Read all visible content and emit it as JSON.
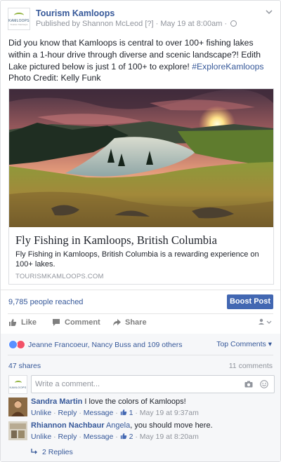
{
  "post": {
    "page_name": "Tourism Kamloops",
    "logo_text": "KAMLOOPS",
    "logo_sub": "Tourism Kamloops",
    "published_by": "Published by Shannon McLeod [?] · May 19 at 8:00am ·",
    "text": "Did you know that Kamloops is central to over 100+ fishing lakes within a 1-hour drive through diverse and scenic landscape?! Edith Lake pictured below is just 1 of 100+ to explore!",
    "hashtag": "#ExploreKamloops",
    "credit": "Photo Credit: Kelly Funk"
  },
  "link_preview": {
    "title": "Fly Fishing in Kamloops, British Columbia",
    "description": "Fly Fishing in Kamloops, British Columbia is a rewarding experience on 100+ lakes.",
    "domain": "TOURISMKAMLOOPS.COM"
  },
  "insights": {
    "reach": "9,785 people reached",
    "boost_label": "Boost Post"
  },
  "actions": {
    "like": "Like",
    "comment": "Comment",
    "share": "Share"
  },
  "feedback": {
    "reactors": "Jeanne Francoeur, Nancy Buss and 109 others",
    "top_comments": "Top Comments ▾",
    "shares": "47 shares",
    "comments": "11 comments",
    "compose_placeholder": "Write a comment..."
  },
  "comments": [
    {
      "author": "Sandra Martin",
      "mention": "",
      "text": "I love the colors of Kamloops!",
      "unlike": "Unlike",
      "reply": "Reply",
      "message": "Message",
      "likes": "1",
      "time": "May 19 at 9:37am"
    },
    {
      "author": "Rhiannon Nachbaur",
      "mention": "Angela",
      "text": ", you should move here.",
      "unlike": "Unlike",
      "reply": "Reply",
      "message": "Message",
      "likes": "2",
      "time": "May 19 at 8:20am"
    }
  ],
  "replies_label": "2 Replies",
  "colors": {
    "link_blue": "#365899",
    "boost_blue": "#4267b2",
    "meta_gray": "#90949c",
    "feedback_bg": "#f6f7f9"
  }
}
